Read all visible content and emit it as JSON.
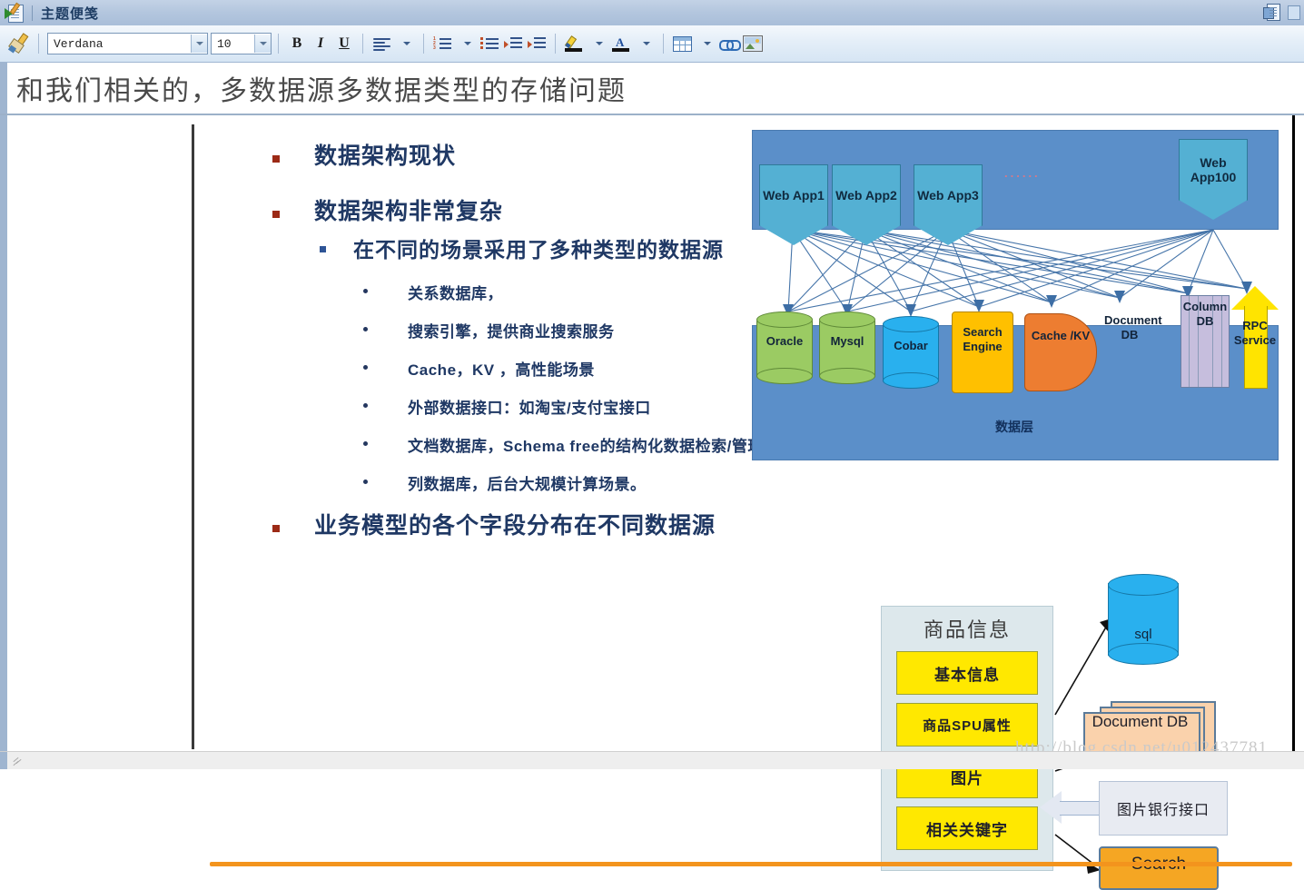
{
  "window": {
    "title": "主题便笺",
    "app_icon": "note-editor-icon",
    "right_icons": [
      "copy-page-icon",
      "small-panel-icon"
    ]
  },
  "toolbar": {
    "format_painter": "format-painter-icon",
    "font_family": "Verdana",
    "font_size": "10",
    "bold": "B",
    "italic": "I",
    "underline": "U",
    "align": "align-left-icon",
    "numbered_list": "numbered-list-icon",
    "bulleted_list": "bulleted-list-icon",
    "decrease_indent": "decrease-indent-icon",
    "increase_indent": "increase-indent-icon",
    "highlight": "highlight-color-icon",
    "font_color": "font-color-icon",
    "table": "insert-table-icon",
    "link": "insert-link-icon",
    "image": "insert-image-icon"
  },
  "heading": {
    "text": "和我们相关的，多数据源多数据类型的存储问题"
  },
  "content": {
    "bullets": [
      {
        "level": 1,
        "text": "数据架构现状"
      },
      {
        "level": 1,
        "text": "数据架构非常复杂"
      },
      {
        "level": 2,
        "text": "在不同的场景采用了多种类型的数据源"
      },
      {
        "level": 3,
        "text": "关系数据库，"
      },
      {
        "level": 3,
        "text": "搜索引擎，提供商业搜索服务"
      },
      {
        "level": 3,
        "text": "Cache，KV        ，高性能场景"
      },
      {
        "level": 3,
        "text": "外部数据接口：如淘宝/支付宝接口"
      },
      {
        "level": 3,
        "text": "文档数据库，Schema free的结构化数据检索/管理场景"
      },
      {
        "level": 3,
        "text": "列数据库，后台大规模计算场景。"
      },
      {
        "level": 1,
        "text": "业务模型的各个字段分布在不同数据源"
      }
    ]
  },
  "architecture_diagram": {
    "web_apps": [
      "Web App1",
      "Web App2",
      "Web App3",
      "Web App100"
    ],
    "ellipsis": "......",
    "data_layer_label": "数据层",
    "data_stores": [
      {
        "name": "Oracle",
        "shape": "cylinder",
        "color": "#9bcb63"
      },
      {
        "name": "Mysql",
        "shape": "cylinder",
        "color": "#9bcb63"
      },
      {
        "name": "Cobar",
        "shape": "cylinder",
        "color": "#29b0ee"
      },
      {
        "name": "Search Engine",
        "shape": "flag",
        "color": "#ffc000"
      },
      {
        "name": "Cache /KV",
        "shape": "pacman",
        "color": "#ed7d31"
      },
      {
        "name": "Document DB",
        "shape": "documents",
        "color": "#fad2ac"
      },
      {
        "name": "Column DB",
        "shape": "columns",
        "color": "#c6bedd"
      },
      {
        "name": "RPC Service",
        "shape": "up-arrow",
        "color": "#ffe400"
      }
    ]
  },
  "product_diagram": {
    "panel_title": "商品信息",
    "fields": [
      "基本信息",
      "商品SPU属性",
      "图片",
      "相关关键字"
    ],
    "targets": [
      {
        "name": "sql",
        "shape": "cylinder",
        "color": "#29b0ee"
      },
      {
        "name": "Document DB",
        "shape": "documents",
        "color": "#fad2ac"
      },
      {
        "name": "图片银行接口",
        "shape": "box",
        "color": "#e8ebf2"
      },
      {
        "name": "Search",
        "shape": "flag",
        "color": "#f5a623"
      }
    ]
  },
  "watermark": {
    "text": "http://blog.csdn.net/u012437781"
  }
}
